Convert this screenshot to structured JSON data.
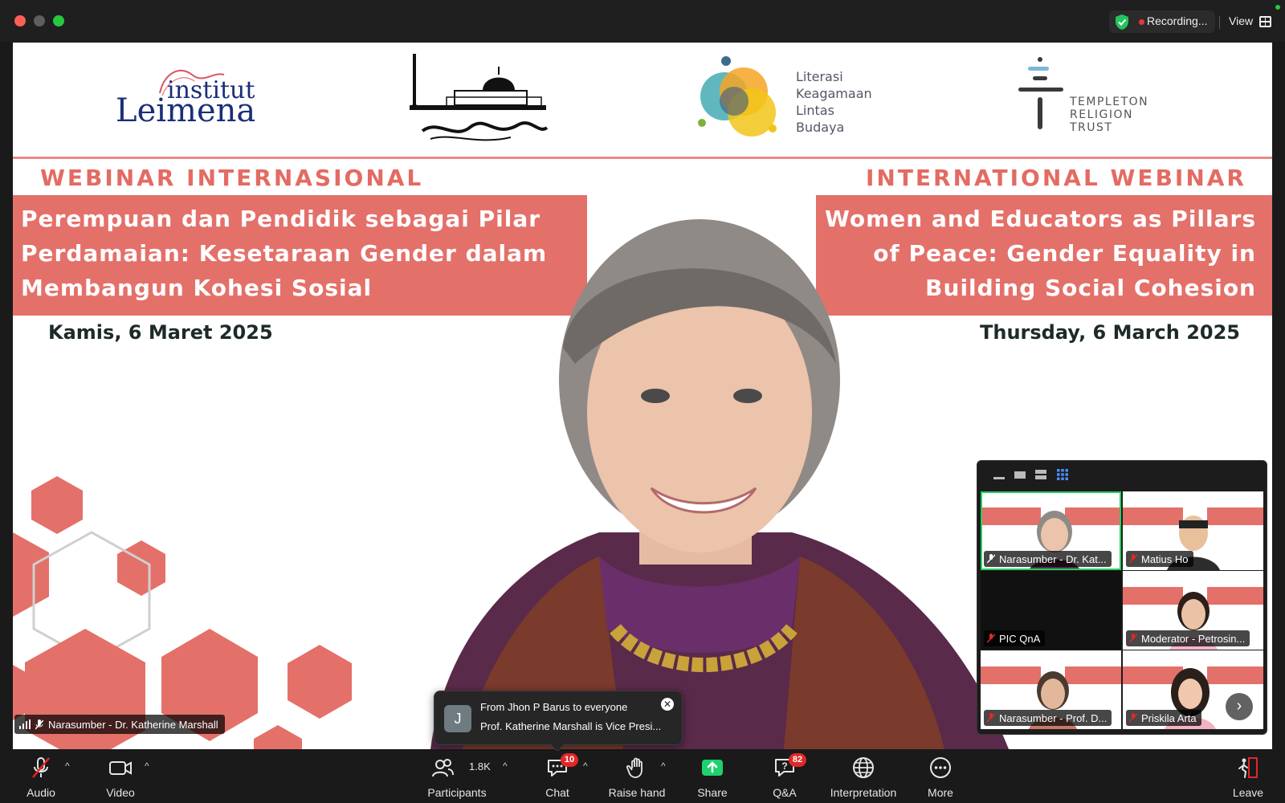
{
  "window": {
    "recording_text": "Recording...",
    "view_label": "View"
  },
  "slide": {
    "heading_id": "WEBINAR INTERNASIONAL",
    "heading_en": "INTERNATIONAL WEBINAR",
    "title_id_lines": [
      "Perempuan dan Pendidik sebagai Pilar",
      "Perdamaian: Kesetaraan Gender dalam",
      "Membangun Kohesi Sosial"
    ],
    "title_en_lines": [
      "Women and Educators as Pillars",
      "of Peace: Gender Equality in",
      "Building Social Cohesion"
    ],
    "date_id": "Kamis, 6 Maret 2025",
    "date_en": "Thursday, 6 March 2025",
    "logos": {
      "leimena_top": "institut",
      "leimena_bottom": "Leimena",
      "literasi": [
        "Literasi",
        "Keagamaan",
        "Lintas",
        "Budaya"
      ],
      "templeton": [
        "TEMPLETON",
        "RELIGION",
        "TRUST"
      ]
    }
  },
  "active_speaker": {
    "name": "Narasumber - Dr. Katherine Marshall"
  },
  "chat_toast": {
    "avatar_letter": "J",
    "from": "From Jhon P Barus to everyone",
    "message": "Prof. Katherine Marshall is Vice Presi..."
  },
  "gallery": {
    "tiles": [
      {
        "label": "Narasumber - Dr. Kat...",
        "active": true
      },
      {
        "label": "Matius Ho",
        "active": false
      },
      {
        "label": "PIC QnA",
        "active": false
      },
      {
        "label": "Moderator - Petrosin...",
        "active": false
      },
      {
        "label": "Narasumber - Prof. D...",
        "active": false
      },
      {
        "label": "Priskila Arta",
        "active": false
      }
    ]
  },
  "toolbar": {
    "audio": "Audio",
    "video": "Video",
    "participants": "Participants",
    "participants_count": "1.8K",
    "chat": "Chat",
    "chat_badge": "10",
    "raise_hand": "Raise hand",
    "share": "Share",
    "qa": "Q&A",
    "qa_badge": "82",
    "interpretation": "Interpretation",
    "more": "More",
    "leave": "Leave"
  },
  "colors": {
    "accent_red": "#e4706a",
    "share_green": "#1fd16c",
    "active_tile_border": "#23d160",
    "badge_red": "#e02828"
  }
}
